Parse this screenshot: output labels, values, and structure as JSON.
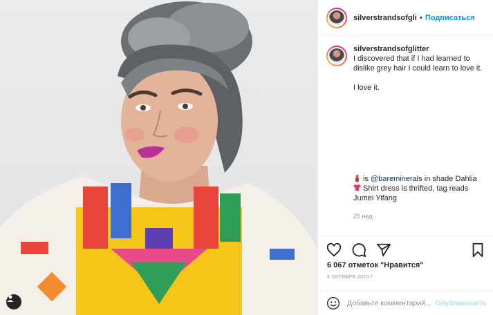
{
  "post": {
    "username": "silverstrandsofglitter",
    "follow_label": "Подписаться",
    "separator": "•",
    "caption_line1": "I discovered that if I had learned to dislike grey hair I could learn to love it.",
    "caption_line2": "I love it.",
    "lipstick_icon": "lipstick-emoji",
    "caption_mention": "@bareminerals",
    "caption_mention_tail": " in shade Dahlia",
    "shirt_icon": "tshirt-emoji",
    "caption_shirt": "Shirt dress is thrifted, tag reads Jumei Yifang",
    "time_ago": "25 нед.",
    "likes": "6 067 отметок \"Нравится\"",
    "date": "8 ОКТЯБРЯ 2020 Г."
  },
  "comment_box": {
    "placeholder": "Добавьте комментарий...",
    "publish_label": "Опубликовать"
  },
  "colors": {
    "accent": "#0095f6",
    "publish_disabled": "#b2dffc",
    "muted": "#8e8e8e",
    "text": "#262626"
  }
}
